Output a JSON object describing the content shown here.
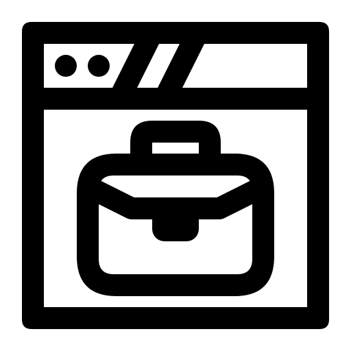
{
  "icon": {
    "name": "browser-window-briefcase-icon",
    "parts": {
      "window": "browser-window-icon",
      "dots": "window-dots-icon",
      "slashes": "title-bar-slashes-icon",
      "briefcase": "briefcase-icon",
      "clasp": "briefcase-clasp-icon"
    }
  },
  "colors": {
    "foreground": "#000000",
    "background": "#ffffff"
  }
}
